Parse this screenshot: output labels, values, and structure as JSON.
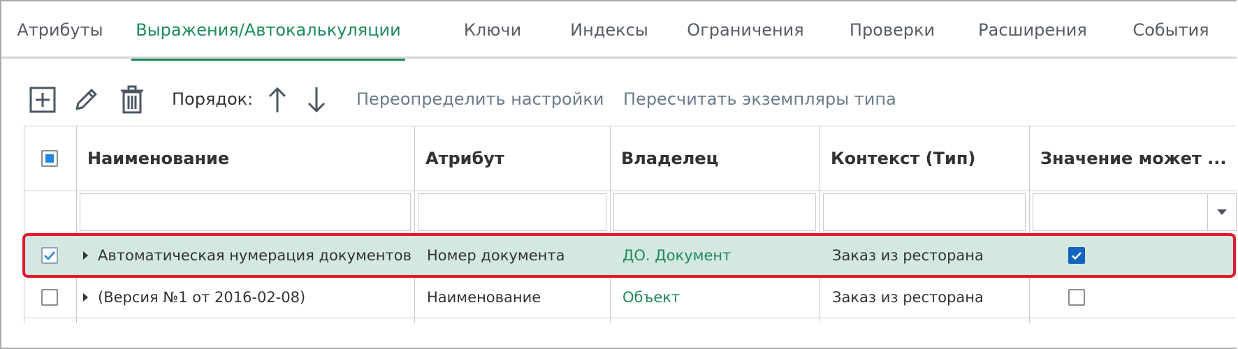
{
  "tabs": [
    {
      "label": "Атрибуты",
      "active": false
    },
    {
      "label": "Выражения/Автокалькуляции",
      "active": true
    },
    {
      "label": "Ключи",
      "active": false
    },
    {
      "label": "Индексы",
      "active": false
    },
    {
      "label": "Ограничения",
      "active": false
    },
    {
      "label": "Проверки",
      "active": false
    },
    {
      "label": "Расширения",
      "active": false
    },
    {
      "label": "События",
      "active": false
    }
  ],
  "toolbar": {
    "add_icon": "plus-square-icon",
    "edit_icon": "pencil-icon",
    "delete_icon": "trash-icon",
    "order_label": "Порядок:",
    "up_icon": "arrow-up-icon",
    "down_icon": "arrow-down-icon",
    "override_label": "Переопределить настройки",
    "recalc_label": "Пересчитать экземпляры типа"
  },
  "table": {
    "columns": [
      "Наименование",
      "Атрибут",
      "Владелец",
      "Контекст (Тип)",
      "Значение может ..."
    ],
    "filters": {
      "name": "",
      "attribute": "",
      "owner": "",
      "context": "",
      "nullable": ""
    },
    "rows": [
      {
        "selected": true,
        "name": "Автоматическая нумерация документов",
        "attribute": "Номер документа",
        "owner": "ДО. Документ",
        "context": "Заказ из ресторана",
        "nullable": true
      },
      {
        "selected": false,
        "name": "(Версия №1 от 2016-02-08)",
        "attribute": "Наименование",
        "owner": "Объект",
        "context": "Заказ из ресторана",
        "nullable": false
      }
    ]
  },
  "colors": {
    "accent": "#1f8a5b",
    "selected_row": "#d2e8e0",
    "highlight": "#e3172f",
    "checkbox": "#1565c0"
  }
}
